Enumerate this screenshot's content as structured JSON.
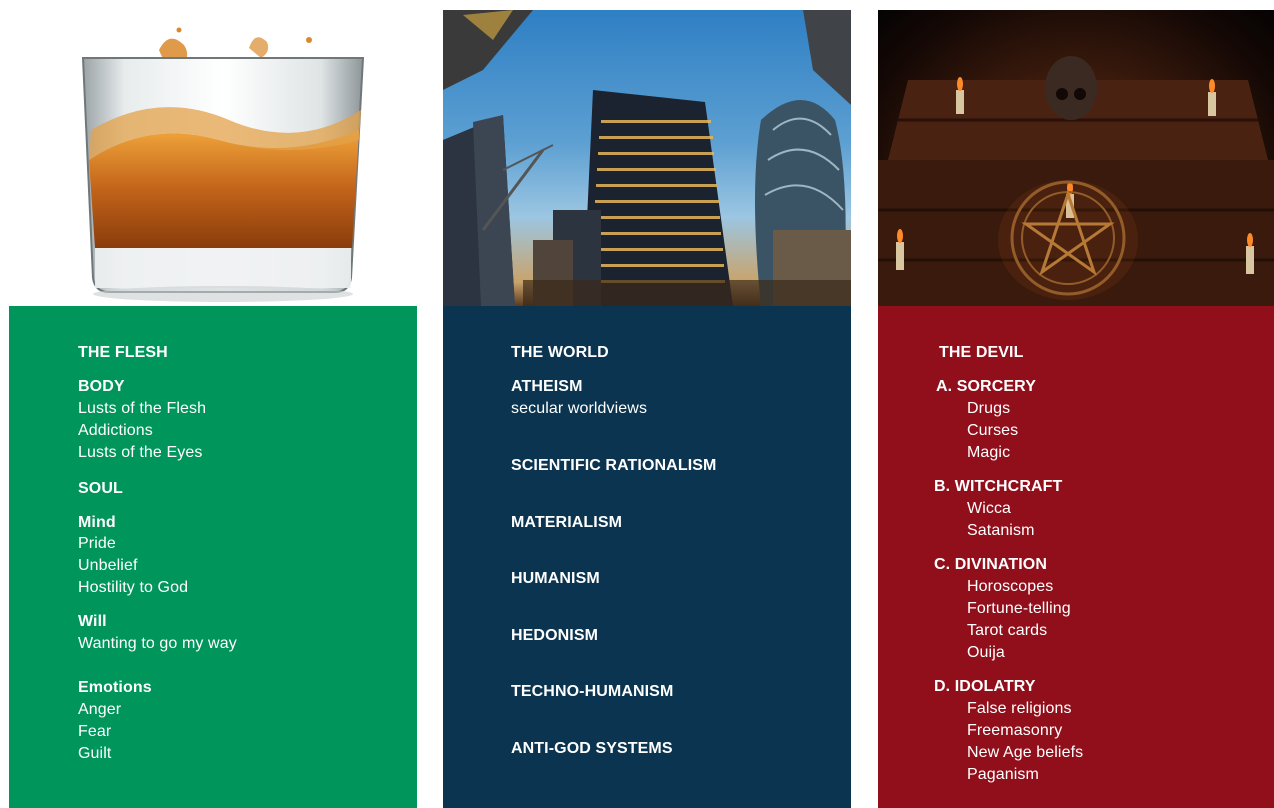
{
  "columns": [
    {
      "title": "THE FLESH",
      "image": "whiskey-glass-image",
      "color": "#00955a"
    },
    {
      "title": "THE WORLD",
      "image": "city-skyscrapers-image",
      "color": "#0a344f"
    },
    {
      "title": "THE DEVIL",
      "image": "occult-altar-pentagram-image",
      "color": "#900f1b"
    }
  ],
  "flesh": {
    "body_heading": "BODY",
    "body_items": [
      "Lusts of the Flesh",
      "Addictions",
      "Lusts of the Eyes"
    ],
    "soul_heading": "SOUL",
    "mind_heading": "Mind",
    "mind_items": [
      "Pride",
      "Unbelief",
      "Hostility to God"
    ],
    "will_heading": "Will",
    "will_items": [
      "Wanting to go my way"
    ],
    "emotions_heading": "Emotions",
    "emotions_items": [
      "Anger",
      "Fear",
      "Guilt"
    ]
  },
  "world": {
    "atheism_heading": "ATHEISM",
    "atheism_sub": "secular worldviews",
    "items": [
      "SCIENTIFIC RATIONALISM",
      "MATERIALISM",
      "HUMANISM",
      "HEDONISM",
      "TECHNO-HUMANISM",
      "ANTI-GOD SYSTEMS"
    ]
  },
  "devil": {
    "sorcery_heading": "A. SORCERY",
    "sorcery_items": [
      "Drugs",
      "Curses",
      "Magic"
    ],
    "witchcraft_heading": "B. WITCHCRAFT",
    "witchcraft_items": [
      "Wicca",
      "Satanism"
    ],
    "divination_heading": "C. DIVINATION",
    "divination_items": [
      "Horoscopes",
      "Fortune-telling",
      "Tarot cards",
      "Ouija"
    ],
    "idolatry_heading": "D. IDOLATRY",
    "idolatry_items": [
      "False religions",
      "Freemasonry",
      "New Age beliefs",
      "Paganism"
    ]
  }
}
